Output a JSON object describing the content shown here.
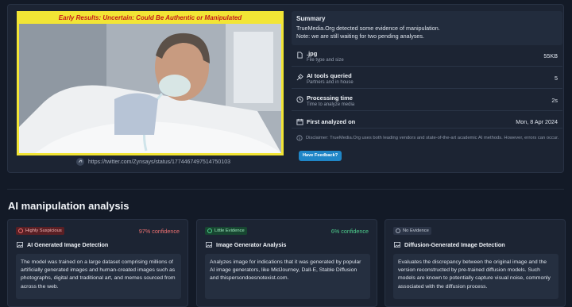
{
  "media": {
    "result_banner": "Early Results: Uncertain: Could Be Authentic or Manipulated",
    "source_url": "https://twitter.com/Zynsays/status/1774467497514750103"
  },
  "summary": {
    "heading": "Summary",
    "line1": "TrueMedia.Org detected some evidence of manipulation.",
    "line2": "Note: we are still waiting for two pending analyses."
  },
  "meta": [
    {
      "label": ".jpg",
      "sub": "File type and size",
      "value": "55KB",
      "icon": "file-icon"
    },
    {
      "label": "AI tools queried",
      "sub": "Partners and in house",
      "value": "5",
      "icon": "tools-icon"
    },
    {
      "label": "Processing time",
      "sub": "Time to analyze media",
      "value": "2s",
      "icon": "clock-icon"
    },
    {
      "label": "First analyzed on",
      "sub": "",
      "value": "Mon, 8 Apr 2024",
      "icon": "calendar-icon"
    }
  ],
  "disclaimer": "Disclaimer: TrueMedia.Org uses both leading vendors and state-of-the-art academic AI methods. However, errors can occur.",
  "feedback_label": "Have Feedback?",
  "section_title": "AI manipulation analysis",
  "cards": [
    {
      "badge": "Highly Suspicious",
      "confidence": "97% confidence",
      "title": "AI Generated Image Detection",
      "body": "The model was trained on a large dataset comprising millions of artificially generated images and human-created images such as photographs, digital and traditional art, and memes sourced from across the web.",
      "badge_color": "#f07272"
    },
    {
      "badge": "Little Evidence",
      "confidence": "6% confidence",
      "title": "Image Generator Analysis",
      "body": "Analyzes image for indications that it was generated by popular AI image generators, like MidJourney, Dall-E, Stable Diffusion and thispersondoesnotexist.com.",
      "badge_color": "#4fd08e"
    },
    {
      "badge": "No Evidence",
      "confidence": "",
      "title": "Diffusion-Generated Image Detection",
      "body": "Evaluates the discrepancy between the original image and the version reconstructed by pre-trained diffusion models. Such models are known to potentially capture visual noise, commonly associated with the diffusion process.",
      "badge_color": "#aab3c2"
    }
  ]
}
